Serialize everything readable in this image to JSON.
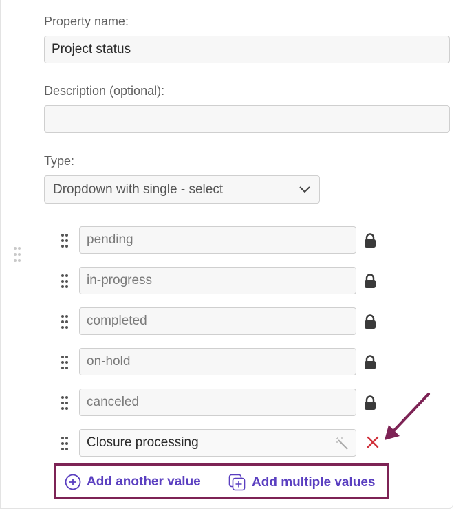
{
  "form": {
    "property_name_label": "Property name:",
    "property_name_value": "Project status",
    "description_label": "Description (optional):",
    "description_value": "",
    "type_label": "Type:",
    "type_selected": "Dropdown with single - select"
  },
  "values": [
    {
      "label": "pending",
      "locked": true
    },
    {
      "label": "in-progress",
      "locked": true
    },
    {
      "label": "completed",
      "locked": true
    },
    {
      "label": "on-hold",
      "locked": true
    },
    {
      "label": "canceled",
      "locked": true
    },
    {
      "label": "Closure processing",
      "locked": false
    }
  ],
  "actions": {
    "add_another_label": "Add another value",
    "add_multiple_label": "Add multiple values"
  },
  "colors": {
    "accent": "#5a3fc0",
    "highlight_box": "#7d2355",
    "remove": "#d0303a"
  },
  "icons": [
    "drag-handle-icon",
    "lock-icon",
    "magic-wand-icon",
    "close-icon",
    "chevron-down-icon",
    "plus-circle-icon",
    "add-multiple-icon"
  ]
}
